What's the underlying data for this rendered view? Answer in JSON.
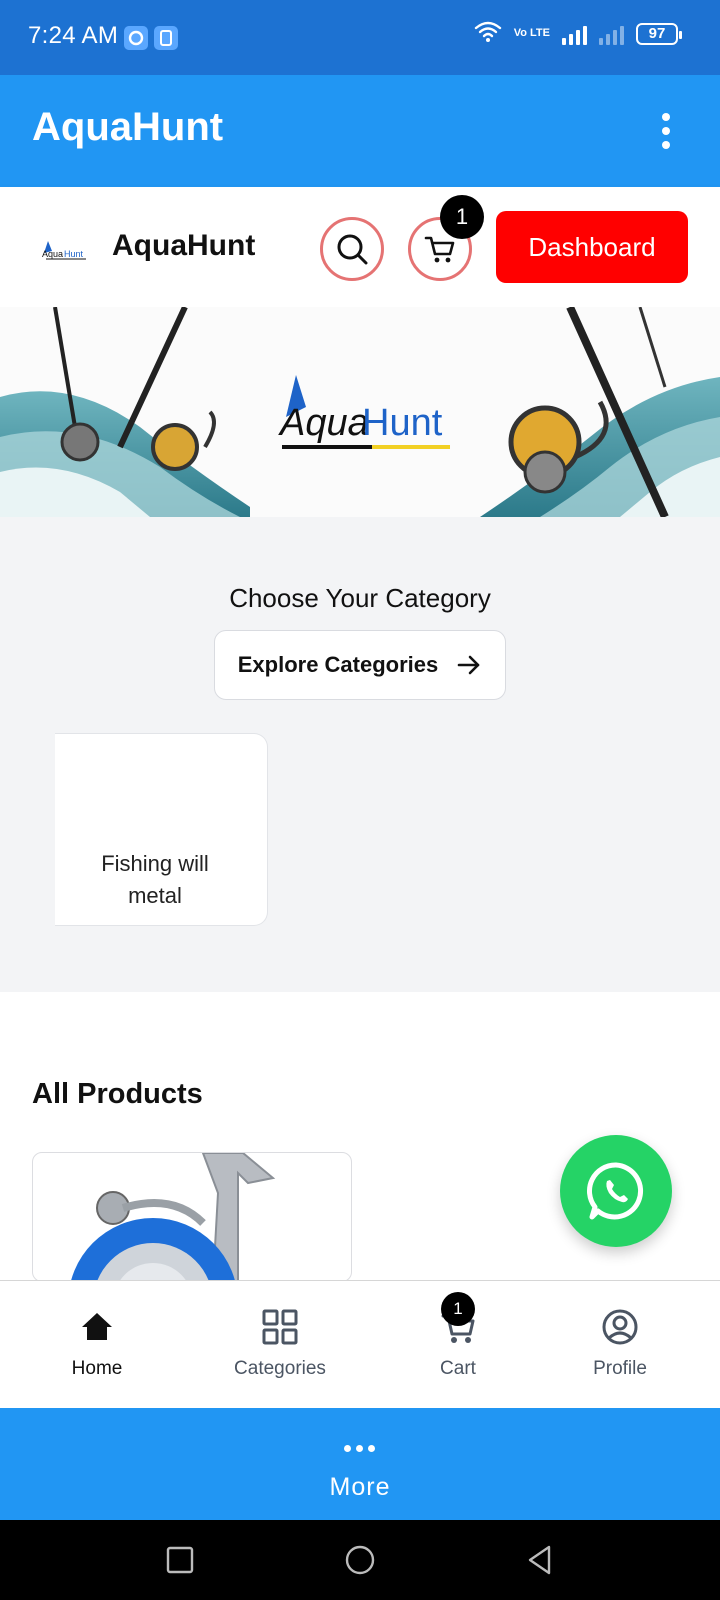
{
  "status_bar": {
    "time": "7:24 AM",
    "network_label": "Vo LTE",
    "battery": "97"
  },
  "app_bar": {
    "title": "AquaHunt"
  },
  "header": {
    "brand": "AquaHunt",
    "logo_text": "AquaHunt",
    "cart_count": "1",
    "dashboard_label": "Dashboard"
  },
  "banner": {
    "logo_text_a": "Aqua",
    "logo_text_b": "Hunt"
  },
  "categories": {
    "heading": "Choose Your Category",
    "explore_label": "Explore Categories",
    "items": [
      {
        "label_line1": "Fishing will",
        "label_line2": "metal"
      }
    ]
  },
  "products": {
    "heading": "All Products"
  },
  "bottom_nav": {
    "items": [
      {
        "label": "Home",
        "icon": "home-icon",
        "active": true
      },
      {
        "label": "Categories",
        "icon": "grid-icon",
        "active": false
      },
      {
        "label": "Cart",
        "icon": "cart-icon",
        "active": false,
        "badge": "1"
      },
      {
        "label": "Profile",
        "icon": "user-icon",
        "active": false
      }
    ]
  },
  "more": {
    "label": "More"
  },
  "colors": {
    "primary": "#2196f3",
    "status_bar": "#1d72d2",
    "dashboard": "#ff0000",
    "whatsapp": "#25d366",
    "search_ring": "#e57373"
  }
}
